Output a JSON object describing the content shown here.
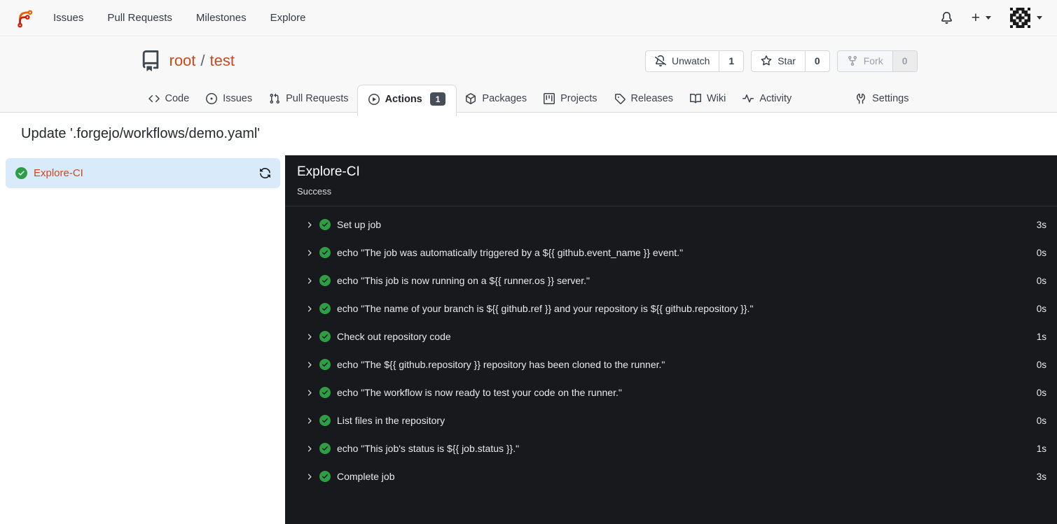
{
  "colors": {
    "primary": "#c9481f",
    "success_green": "#2c9f45",
    "panel_bg": "#17191c",
    "sidebar_active_bg": "#d9ebfb",
    "badge_bg": "#454e59"
  },
  "navbar": {
    "links": [
      {
        "label": "Issues"
      },
      {
        "label": "Pull Requests"
      },
      {
        "label": "Milestones"
      },
      {
        "label": "Explore"
      }
    ],
    "icons": [
      {
        "name": "bell"
      },
      {
        "name": "plus"
      },
      {
        "name": "avatar"
      }
    ]
  },
  "repo": {
    "owner": "root",
    "separator": "/",
    "name": "test",
    "actions": [
      {
        "label": "Unwatch",
        "count": "1",
        "icon": "bell-slash",
        "disabled": false
      },
      {
        "label": "Star",
        "count": "0",
        "icon": "star",
        "disabled": false
      },
      {
        "label": "Fork",
        "count": "0",
        "icon": "fork",
        "disabled": true
      }
    ]
  },
  "tabs": [
    {
      "label": "Code",
      "icon": "code"
    },
    {
      "label": "Issues",
      "icon": "issue"
    },
    {
      "label": "Pull Requests",
      "icon": "pr"
    },
    {
      "label": "Actions",
      "icon": "play",
      "badge": "1",
      "active": true
    },
    {
      "label": "Packages",
      "icon": "package"
    },
    {
      "label": "Projects",
      "icon": "project"
    },
    {
      "label": "Releases",
      "icon": "tag"
    },
    {
      "label": "Wiki",
      "icon": "book"
    },
    {
      "label": "Activity",
      "icon": "pulse"
    },
    {
      "label": "Settings",
      "icon": "tools",
      "right": true
    }
  ],
  "page": {
    "title": "Update '.forgejo/workflows/demo.yaml'"
  },
  "job_list": [
    {
      "name": "Explore-CI",
      "status": "success",
      "active": true
    }
  ],
  "job_panel": {
    "title": "Explore-CI",
    "status": "Success",
    "steps": [
      {
        "name": "Set up job",
        "duration": "3s"
      },
      {
        "name": "echo \"The job was automatically triggered by a ${{ github.event_name }} event.\"",
        "duration": "0s"
      },
      {
        "name": "echo \"This job is now running on a ${{ runner.os }} server.\"",
        "duration": "0s"
      },
      {
        "name": "echo \"The name of your branch is ${{ github.ref }} and your repository is ${{ github.repository }}.\"",
        "duration": "0s"
      },
      {
        "name": "Check out repository code",
        "duration": "1s"
      },
      {
        "name": "echo \"The ${{ github.repository }} repository has been cloned to the runner.\"",
        "duration": "0s"
      },
      {
        "name": "echo \"The workflow is now ready to test your code on the runner.\"",
        "duration": "0s"
      },
      {
        "name": "List files in the repository",
        "duration": "0s"
      },
      {
        "name": "echo \"This job's status is ${{ job.status }}.\"",
        "duration": "1s"
      },
      {
        "name": "Complete job",
        "duration": "3s"
      }
    ]
  }
}
